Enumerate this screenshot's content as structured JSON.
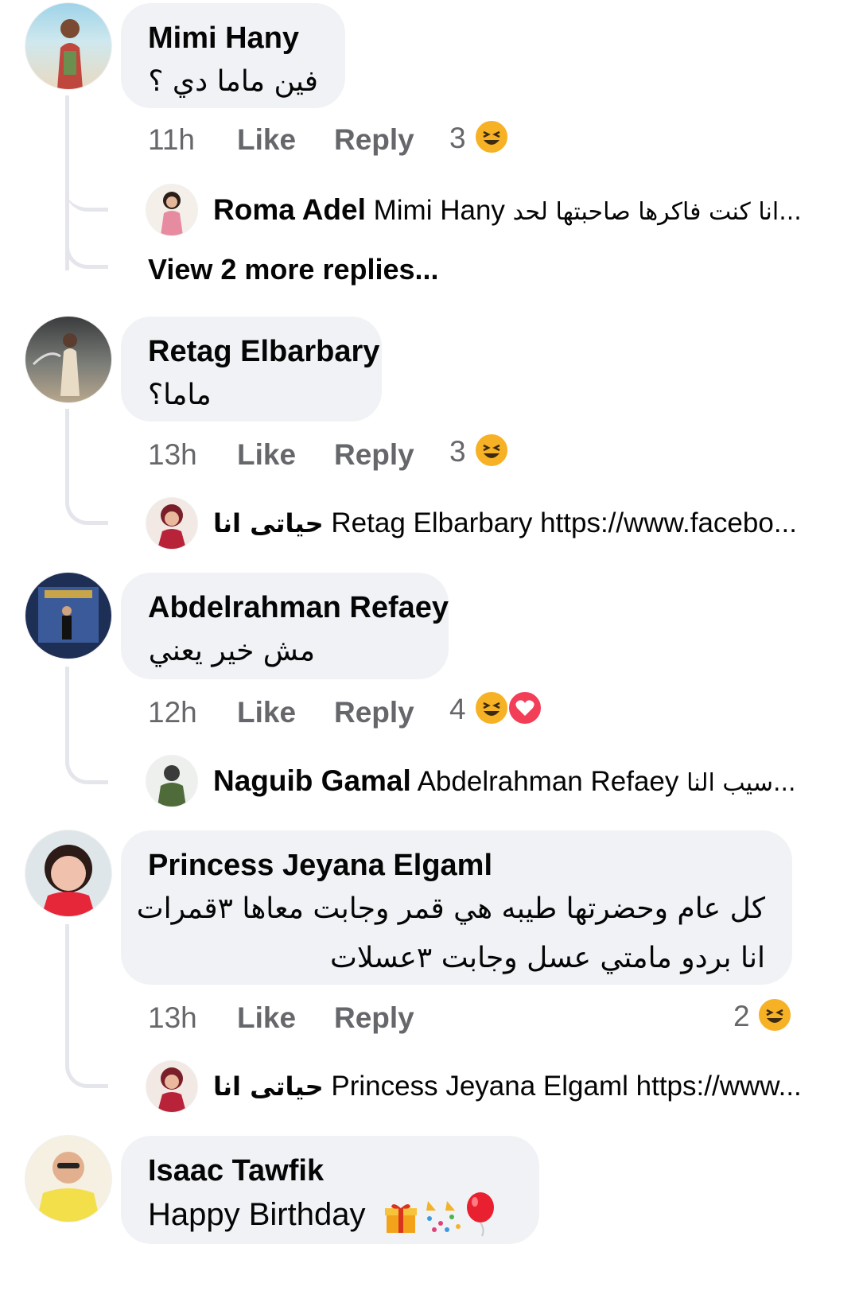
{
  "comments": [
    {
      "name": "Mimi Hany",
      "text": "فين ماما دي ؟",
      "time": "11h",
      "like": "Like",
      "reply": "Reply",
      "reaction_count": "3",
      "reactions": [
        "haha"
      ],
      "reply_preview": {
        "author": "Roma Adel",
        "mention": "Mimi Hany",
        "text": "انا كنت فاكرها صاحبتها لحد..."
      },
      "more_replies": "View 2 more replies..."
    },
    {
      "name": "Retag Elbarbary",
      "text": "ماما؟",
      "time": "13h",
      "like": "Like",
      "reply": "Reply",
      "reaction_count": "3",
      "reactions": [
        "haha"
      ],
      "reply_preview": {
        "author": "حياتى انا",
        "mention": "Retag Elbarbary",
        "text": "https://www.facebo..."
      }
    },
    {
      "name": "Abdelrahman Refaey",
      "text": "مش خير يعني",
      "time": "12h",
      "like": "Like",
      "reply": "Reply",
      "reaction_count": "4",
      "reactions": [
        "haha",
        "love"
      ],
      "reply_preview": {
        "author": "Naguib Gamal",
        "mention": "Abdelrahman Refaey",
        "text": "سيب النا..."
      }
    },
    {
      "name": "Princess Jeyana Elgaml",
      "text_line1": "كل عام وحضرتها طيبه هي قمر وجابت معاها ٣قمرات",
      "text_line2": "انا بردو مامتي عسل وجابت ٣عسلات",
      "time": "13h",
      "like": "Like",
      "reply": "Reply",
      "reaction_count": "2",
      "reactions": [
        "haha"
      ],
      "reply_preview": {
        "author": "حياتى انا",
        "mention": "Princess Jeyana Elgaml",
        "text": "https://www..."
      }
    },
    {
      "name": "Isaac Tawfik",
      "text": "Happy Birthday",
      "emojis": [
        "gift-icon",
        "confetti-icon",
        "balloon-icon"
      ]
    }
  ],
  "colors": {
    "bubble": "#f0f2f5",
    "meta_text": "#65676b",
    "thread_line": "#e4e6eb",
    "haha": "#f7b125",
    "love": "#f33e58"
  }
}
